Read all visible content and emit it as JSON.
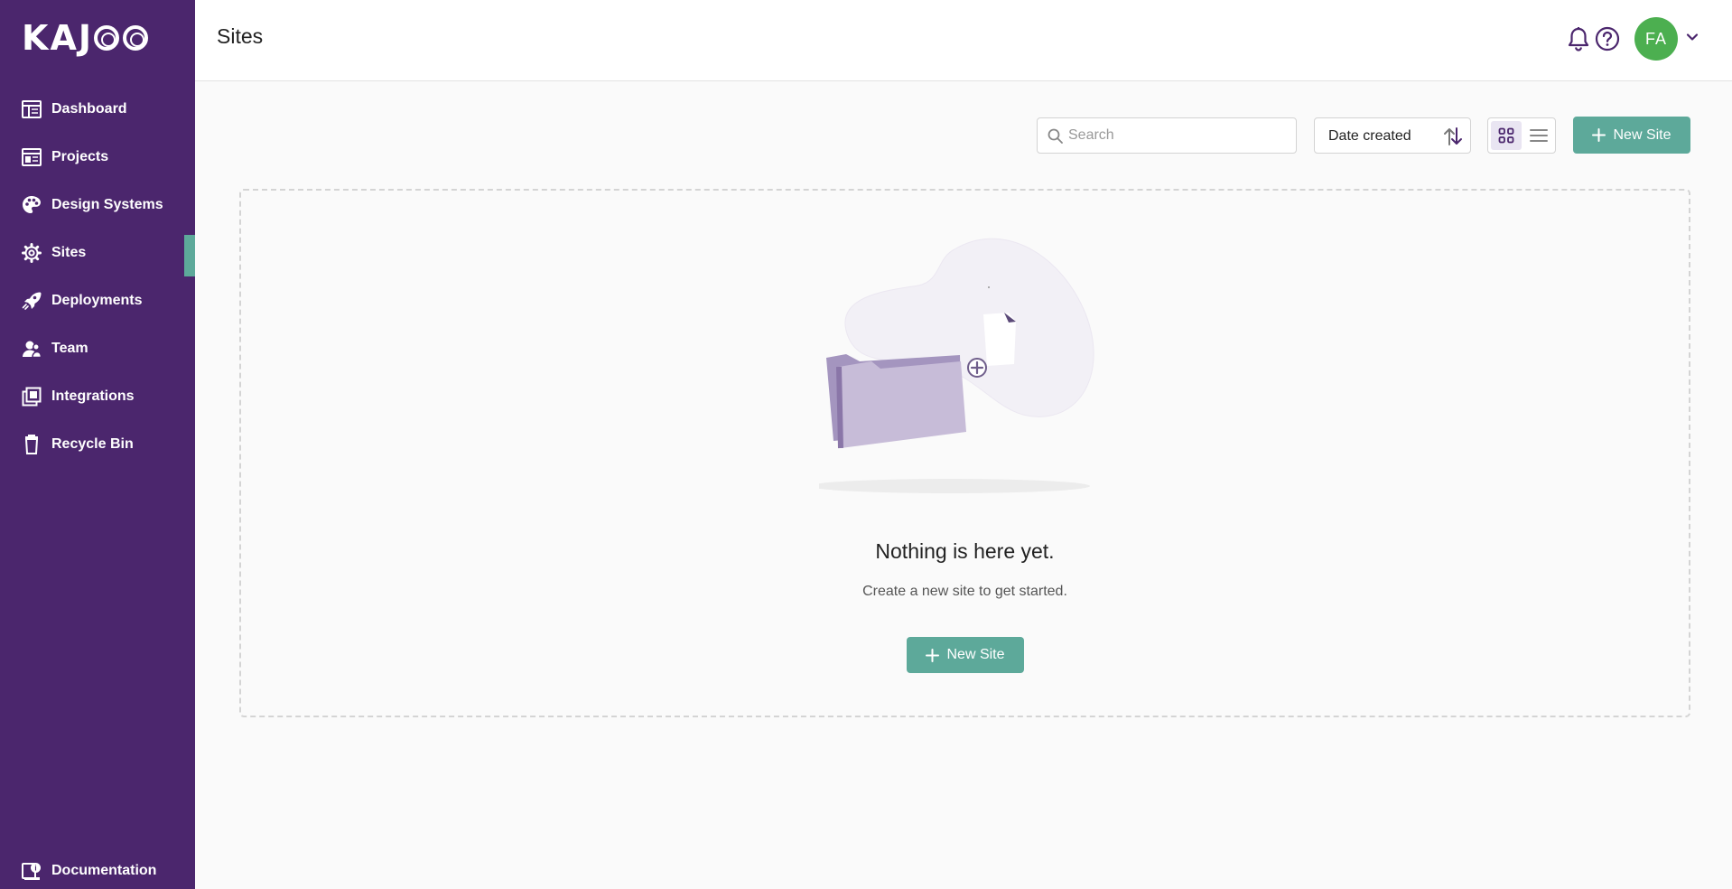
{
  "app": {
    "logo_text": "KAJOO"
  },
  "sidebar": {
    "items": [
      {
        "label": "Dashboard",
        "icon": "dashboard-icon"
      },
      {
        "label": "Projects",
        "icon": "projects-icon"
      },
      {
        "label": "Design Systems",
        "icon": "palette-icon"
      },
      {
        "label": "Sites",
        "icon": "gear-icon",
        "active": true
      },
      {
        "label": "Deployments",
        "icon": "rocket-icon"
      },
      {
        "label": "Team",
        "icon": "team-icon"
      },
      {
        "label": "Integrations",
        "icon": "integrations-icon"
      },
      {
        "label": "Recycle Bin",
        "icon": "trash-icon"
      }
    ],
    "footer": {
      "label": "Documentation",
      "icon": "documentation-icon"
    }
  },
  "header": {
    "title": "Sites",
    "avatar_initials": "FA"
  },
  "toolbar": {
    "search_placeholder": "Search",
    "sort_value": "Date created",
    "new_site_label": "New Site"
  },
  "empty_state": {
    "title": "Nothing is here yet.",
    "subtitle": "Create a new site to get started.",
    "button_label": "New Site"
  },
  "colors": {
    "sidebar_bg": "#4b266d",
    "accent_green": "#5da99a",
    "avatar_bg": "#4caf50",
    "illustration_purple": "#c7bcd8"
  }
}
